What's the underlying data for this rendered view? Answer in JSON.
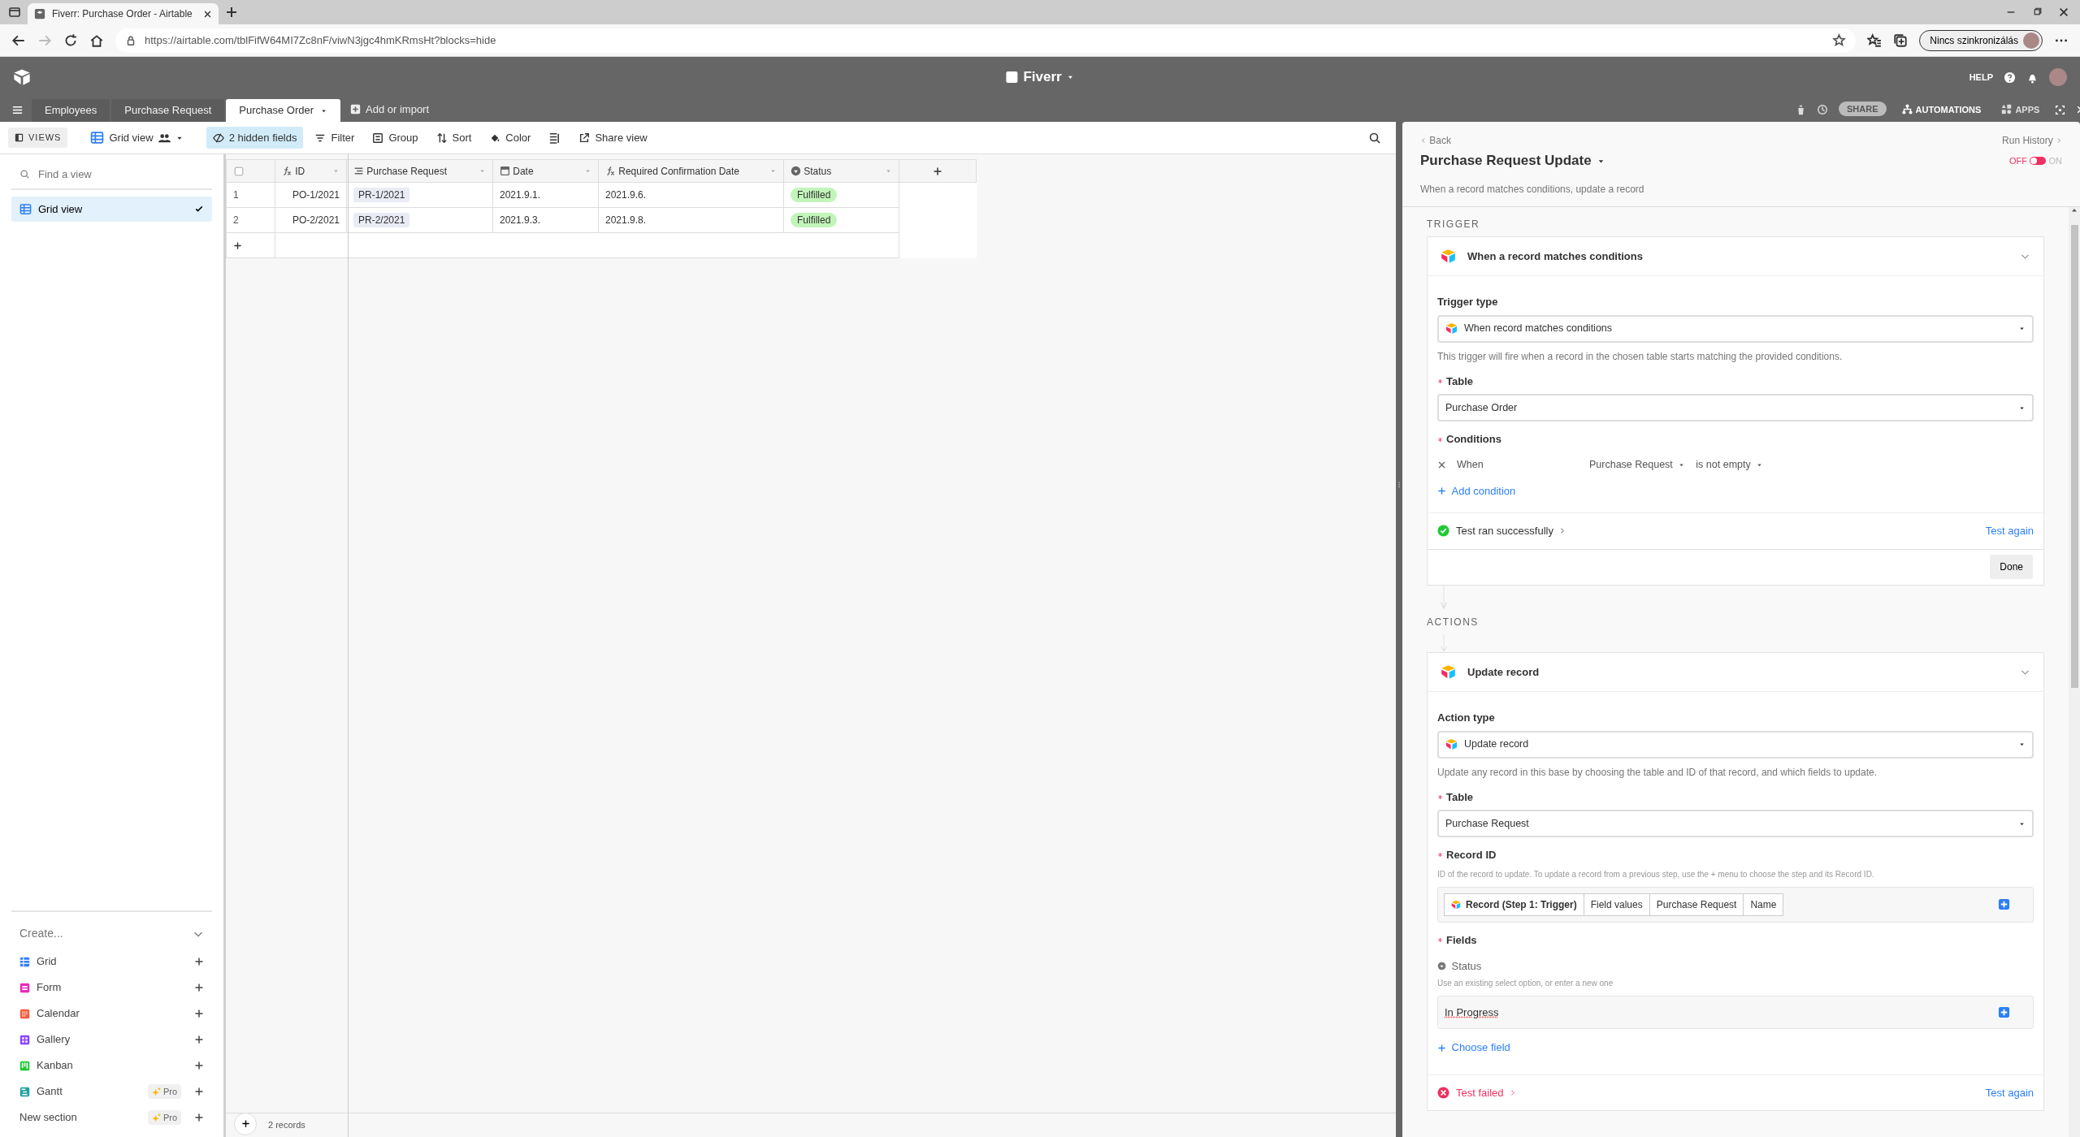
{
  "browser": {
    "tab_title": "Fiverr: Purchase Order - Airtable",
    "url": "https://airtable.com/tblFifW64MI7Zc8nF/viwN3jgc4hmKRmsHt?blocks=hide",
    "profile": "Nincs szinkronizálás"
  },
  "header": {
    "base_name": "Fiverr",
    "help": "HELP"
  },
  "tables": [
    {
      "label": "Employees",
      "selected": false
    },
    {
      "label": "Purchase Request",
      "selected": false
    },
    {
      "label": "Purchase Order",
      "selected": true
    }
  ],
  "add_table": "Add or import",
  "share": "SHARE",
  "panel_tabs": [
    {
      "kind": "automations",
      "label": "AUTOMATIONS",
      "selected": true
    },
    {
      "kind": "apps",
      "label": "APPS",
      "selected": false
    }
  ],
  "toolbar": {
    "views": "VIEWS",
    "view_name": "Grid view",
    "hidden_fields": "2 hidden fields",
    "buttons": [
      {
        "kind": "filter",
        "label": "Filter"
      },
      {
        "kind": "group",
        "label": "Group"
      },
      {
        "kind": "sort",
        "label": "Sort"
      },
      {
        "kind": "color",
        "label": "Color"
      },
      {
        "kind": "height"
      },
      {
        "kind": "share",
        "label": "Share view"
      }
    ]
  },
  "sidebar": {
    "find_placeholder": "Find a view",
    "views": [
      {
        "label": "Grid view",
        "selected": true
      }
    ],
    "create_label": "Create...",
    "create_items": [
      {
        "kind": "grid",
        "label": "Grid",
        "color": "#2d7ff9"
      },
      {
        "kind": "form",
        "label": "Form",
        "color": "#e929ba"
      },
      {
        "kind": "calendar",
        "label": "Calendar",
        "color": "#f55d3e"
      },
      {
        "kind": "gallery",
        "label": "Gallery",
        "color": "#8b46ff"
      },
      {
        "kind": "kanban",
        "label": "Kanban",
        "color": "#20c933"
      },
      {
        "kind": "gantt",
        "label": "Gantt",
        "color": "#20a0a0",
        "badge": "Pro"
      },
      {
        "kind": "section",
        "label": "New section",
        "badge": "Pro"
      }
    ]
  },
  "grid": {
    "select_all_checked": false,
    "columns": [
      {
        "kind": "formula",
        "label": "ID"
      },
      {
        "kind": "link",
        "label": "Purchase Request"
      },
      {
        "kind": "date",
        "label": "Date"
      },
      {
        "kind": "formula",
        "label": "Required Confirmation Date"
      },
      {
        "kind": "select",
        "label": "Status"
      }
    ],
    "rows": [
      {
        "number": "1",
        "cells": [
          "PO-1/2021",
          "PR-1/2021",
          "2021.9.1.",
          "2021.9.6.",
          "Fulfilled"
        ]
      },
      {
        "number": "2",
        "cells": [
          "PO-2/2021",
          "PR-2/2021",
          "2021.9.3.",
          "2021.9.8.",
          "Fulfilled"
        ]
      }
    ],
    "record_count": "2 records"
  },
  "automation": {
    "back": "Back",
    "run_history": "Run History",
    "title": "Purchase Request Update",
    "toggle": {
      "off_label": "OFF",
      "on_label": "ON",
      "on": false
    },
    "description": "When a record matches conditions, update a record",
    "trigger": {
      "heading": "TRIGGER",
      "step_title": "When a record matches conditions",
      "type_label": "Trigger type",
      "type_value": "When record matches conditions",
      "help": "This trigger will fire when a record in the chosen table starts matching the provided conditions.",
      "table_label": "Table",
      "table_value": "Purchase Order",
      "conditions_label": "Conditions",
      "condition": {
        "when": "When",
        "field": "Purchase Request",
        "operator": "is not empty"
      },
      "add_condition": "Add condition",
      "test": {
        "kind": "success",
        "text": "Test ran successfully",
        "again": "Test again"
      },
      "done": "Done"
    },
    "action": {
      "heading": "ACTIONS",
      "step_title": "Update record",
      "type_label": "Action type",
      "type_value": "Update record",
      "help": "Update any record in this base by choosing the table and ID of that record, and which fields to update.",
      "table_label": "Table",
      "table_value": "Purchase Request",
      "record_label": "Record ID",
      "record_help": "ID of the record to update. To update a record from a previous step, use the + menu to choose the step and its Record ID.",
      "tokens": [
        "Record (Step 1: Trigger)",
        "Field values",
        "Purchase Request",
        "Name"
      ],
      "fields_label": "Fields",
      "field": {
        "name": "Status",
        "help": "Use an existing select option, or enter a new one",
        "value": "In Progress"
      },
      "choose_field": "Choose field",
      "test": {
        "kind": "failed",
        "text": "Test failed",
        "again": "Test again"
      }
    }
  }
}
